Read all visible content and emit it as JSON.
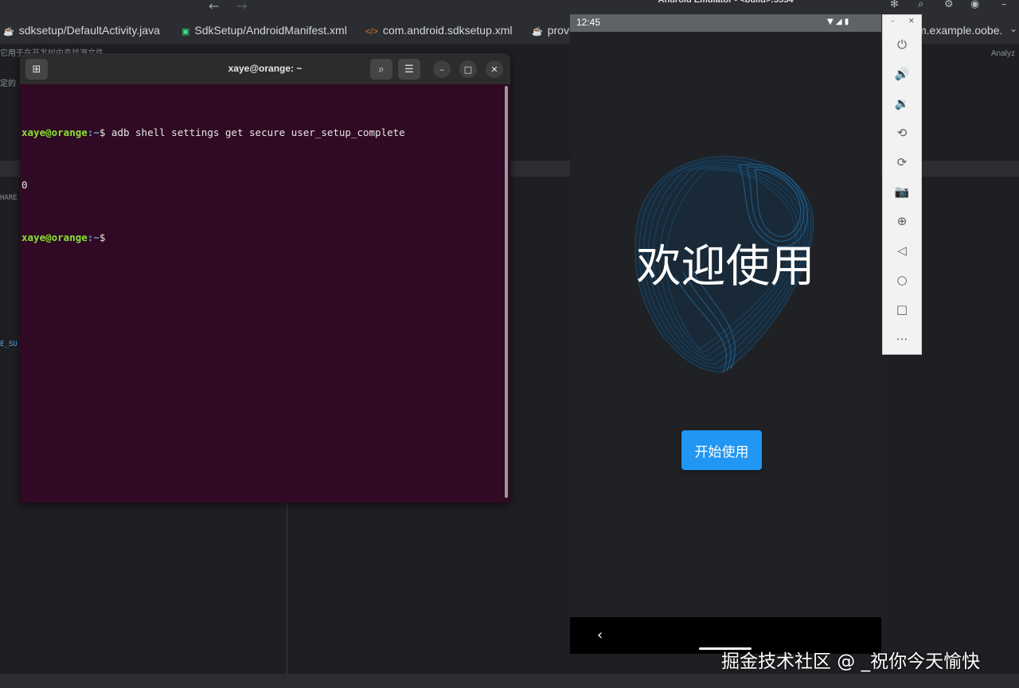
{
  "ide": {
    "tabs": [
      {
        "label": "sdksetup/DefaultActivity.java",
        "icon": "java-file-icon"
      },
      {
        "label": "SdkSetup/AndroidManifest.xml",
        "icon": "android-file-icon"
      },
      {
        "label": "com.android.sdksetup.xml",
        "icon": "xml-file-icon"
      },
      {
        "label": "provi",
        "icon": "java-file-icon"
      },
      {
        "label": "m.example.oobe.",
        "icon": ""
      }
    ],
    "fragments": {
      "line1": "它用于在开发树中查找源文件",
      "line2": "定的",
      "share": "HARE",
      "esu": "E_SU",
      "analyze": "Analyz"
    }
  },
  "terminal": {
    "title": "xaye@orange: ~",
    "lines": [
      {
        "user": "xaye@orange",
        "path": ":~",
        "prompt": "$ ",
        "command": "adb shell settings get secure user_setup_complete"
      },
      {
        "output": "0"
      },
      {
        "user": "xaye@orange",
        "path": ":~",
        "prompt": "$",
        "command": ""
      }
    ]
  },
  "emulator": {
    "title": "Android Emulator - <build>:5554",
    "status_time": "12:45",
    "welcome_text": "欢迎使用",
    "start_button": "开始使用",
    "toolbar_icons": [
      "power-icon",
      "volume-up-icon",
      "volume-down-icon",
      "rotate-left-icon",
      "rotate-right-icon",
      "camera-icon",
      "zoom-icon",
      "back-icon",
      "home-icon",
      "overview-icon",
      "more-icon"
    ]
  },
  "watermark": "掘金技术社区 @ _祝你今天愉快",
  "colors": {
    "terminal_bg": "#300a24",
    "prompt_user": "#8ae234",
    "prompt_path": "#729fcf",
    "button_blue": "#2196f3",
    "swirl_blue": "#1e6fa8"
  }
}
